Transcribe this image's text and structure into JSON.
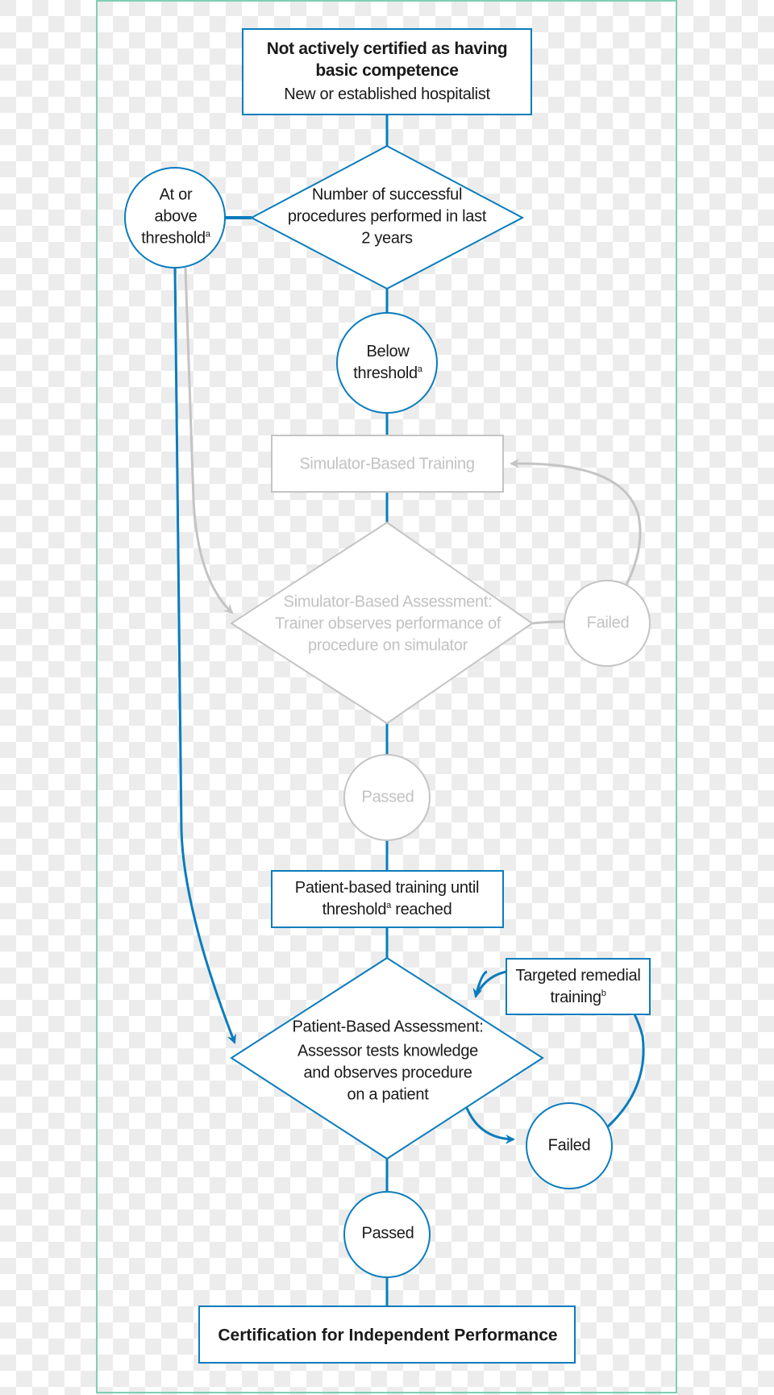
{
  "colors": {
    "active": "#0a7cbd",
    "inactive": "#c4c4c4",
    "frame": "#7fcfb3",
    "text": "#1a1a1a",
    "inactive_text": "#c2c2c2"
  },
  "nodes": {
    "start": {
      "title_line1": "Not actively certified as having",
      "title_line2": "basic competence",
      "subtitle": "New or established hospitalist"
    },
    "decision_procedures": {
      "line1": "Number of successful",
      "line2": "procedures performed in last",
      "line3": "2 years"
    },
    "at_or_above": {
      "line1": "At or",
      "line2": "above",
      "line3": "threshold",
      "footnote": "a"
    },
    "below": {
      "line1": "Below",
      "line2": "threshold",
      "footnote": "a"
    },
    "simulator_training": {
      "label": "Simulator-Based Training",
      "state": "inactive"
    },
    "simulator_assessment": {
      "line1": "Simulator-Based Assessment:",
      "line2": "Trainer observes performance of",
      "line3": "procedure on simulator",
      "state": "inactive"
    },
    "simulator_failed": {
      "label": "Failed",
      "state": "inactive"
    },
    "simulator_passed": {
      "label": "Passed",
      "state": "inactive"
    },
    "patient_training": {
      "line1": "Patient-based training until",
      "line2_pre": "threshold",
      "footnote": "a",
      "line2_post": " reached"
    },
    "patient_assessment": {
      "line1": "Patient-Based Assessment:",
      "line2": "Assessor tests knowledge",
      "line3": "and observes procedure",
      "line4": "on a patient"
    },
    "remedial": {
      "line1": "Targeted remedial",
      "line2": "training",
      "footnote": "b"
    },
    "patient_failed": {
      "label": "Failed"
    },
    "patient_passed": {
      "label": "Passed"
    },
    "certification": {
      "label": "Certification for Independent Performance"
    }
  }
}
